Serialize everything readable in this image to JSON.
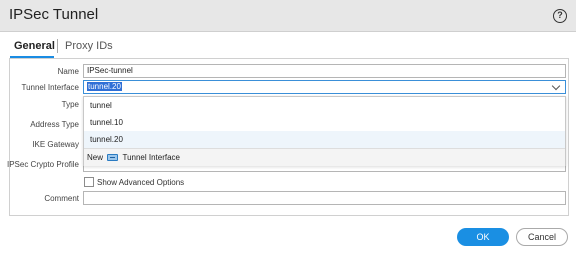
{
  "dialog": {
    "title": "IPSec Tunnel",
    "help_symbol": "?"
  },
  "tabs": [
    {
      "label": "General",
      "active": true
    },
    {
      "label": "Proxy IDs",
      "active": false
    }
  ],
  "form": {
    "name_label": "Name",
    "name_value": "IPSec-tunnel",
    "tunnel_interface_label": "Tunnel Interface",
    "tunnel_interface_value": "tunnel.20",
    "type_label": "Type",
    "address_type_label": "Address Type",
    "ike_gateway_label": "IKE Gateway",
    "ipsec_crypto_profile_label": "IPSec Crypto Profile",
    "show_advanced_label": "Show Advanced Options",
    "show_advanced_checked": false,
    "comment_label": "Comment",
    "comment_value": ""
  },
  "dropdown": {
    "options": [
      "tunnel",
      "tunnel.10",
      "tunnel.20"
    ],
    "highlighted": "tunnel.20",
    "new_prefix": "New",
    "new_item_label": "Tunnel Interface",
    "new_item_icon": "tunnel-interface-icon"
  },
  "buttons": {
    "ok_label": "OK",
    "cancel_label": "Cancel"
  },
  "colors": {
    "accent": "#1a8fe3",
    "selection": "#2f6fd6",
    "titlebar": "#e7e7e7"
  }
}
